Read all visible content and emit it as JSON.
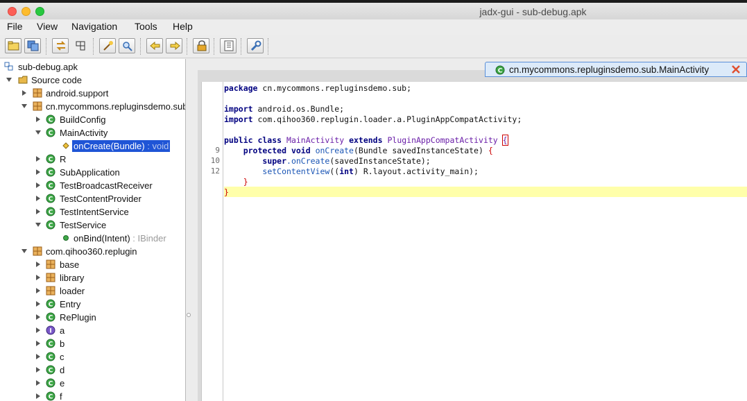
{
  "window": {
    "title": "jadx-gui - sub-debug.apk"
  },
  "menu": [
    "File",
    "View",
    "Navigation",
    "Tools",
    "Help"
  ],
  "toolbar": {
    "buttons": [
      "open-file-icon",
      "save-all-icon",
      "sync-icon",
      "flatten-icon",
      "decompile-icon",
      "search-icon",
      "back-icon",
      "forward-icon",
      "preferences-lock-icon",
      "log-icon",
      "settings-wrench-icon"
    ]
  },
  "tree": {
    "root": "sub-debug.apk",
    "source_code": "Source code",
    "pkg_android_support": "android.support",
    "pkg_main": "cn.mycommons.repluginsdemo.sub",
    "build_config": "BuildConfig",
    "main_activity": "MainActivity",
    "on_create": "onCreate(Bundle)",
    "on_create_ret": " : void",
    "r": "R",
    "sub_application": "SubApplication",
    "test_broadcast": "TestBroadcastReceiver",
    "test_content": "TestContentProvider",
    "test_intent": "TestIntentService",
    "test_service": "TestService",
    "on_bind": "onBind(Intent)",
    "on_bind_ret": " : IBinder",
    "pkg_qihoo": "com.qihoo360.replugin",
    "base": "base",
    "library": "library",
    "loader": "loader",
    "entry": "Entry",
    "replugin": "RePlugin",
    "a": "a",
    "b": "b",
    "c": "c",
    "d": "d",
    "e": "e",
    "f": "f"
  },
  "editor": {
    "tab_label": "cn.mycommons.repluginsdemo.sub.MainActivity",
    "line_numbers": [
      "9",
      "10",
      "12"
    ],
    "code": {
      "l1_kw": "package",
      "l1_rest": " cn.mycommons.repluginsdemo.sub;",
      "l3_kw": "import",
      "l3_rest": " android.os.Bundle;",
      "l4_kw": "import",
      "l4_rest": " com.qihoo360.replugin.loader.a.PluginAppCompatActivity;",
      "l6_kw1": "public class",
      "l6_cls": "MainActivity",
      "l6_kw2": "extends",
      "l6_cls2": "PluginAppCompatActivity",
      "l6_brace": "{",
      "l7_kw": "protected void",
      "l7_mth": "onCreate",
      "l7_rest": "(Bundle savedInstanceState)",
      "l7_brace": "{",
      "l8_kw": "super",
      "l8_mth": ".onCreate",
      "l8_rest": "(savedInstanceState);",
      "l9_mth": "setContentView",
      "l9_p1": "((",
      "l9_kw": "int",
      "l9_rest": ") R.layout.activity_main);",
      "l10_brace": "}",
      "l11_brace": "}"
    }
  },
  "colors": {
    "selection": "#1f55d6",
    "keyword": "#000080",
    "class_name": "#6a1ea8",
    "current_line": "#ffffaa",
    "tab_bg": "#dceaf9"
  }
}
